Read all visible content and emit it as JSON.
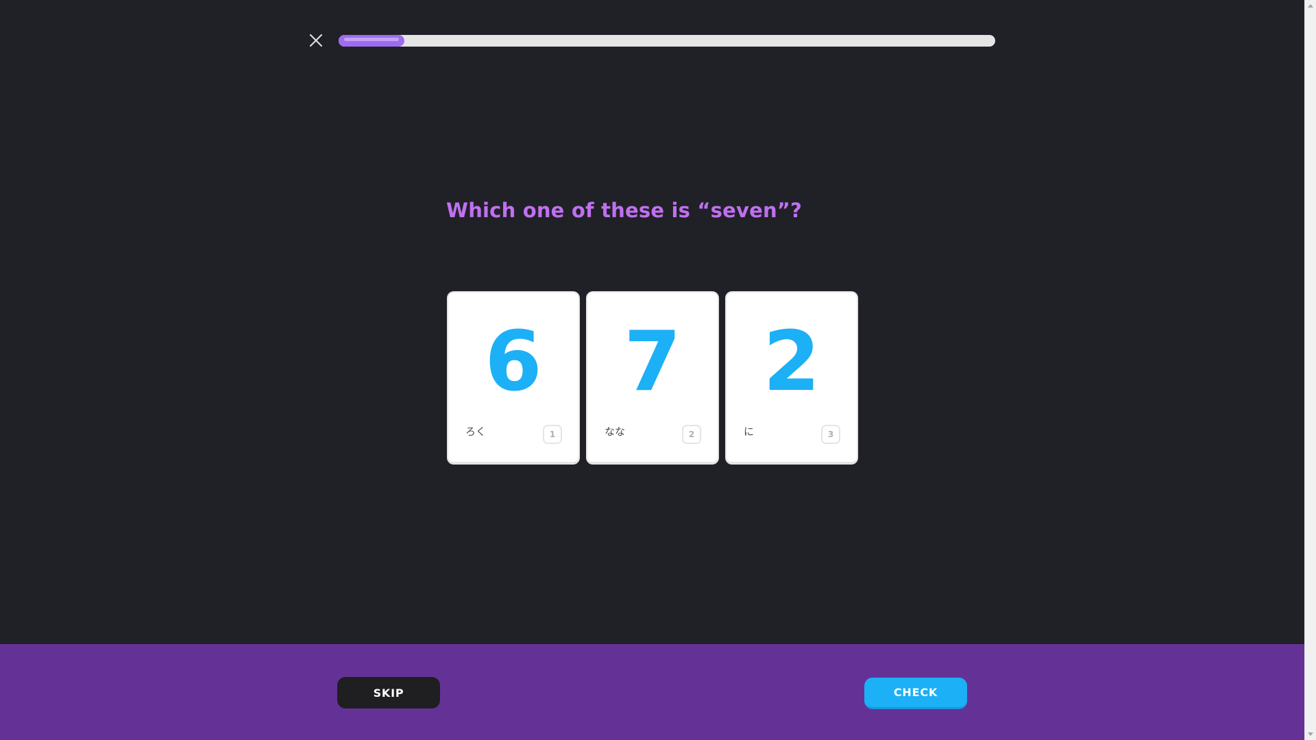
{
  "header": {
    "progress_fraction": 0.1
  },
  "question": {
    "text": "Which one of these is “seven”?"
  },
  "choices": [
    {
      "numeral": "6",
      "label": "ろく",
      "key": "1"
    },
    {
      "numeral": "7",
      "label": "なな",
      "key": "2"
    },
    {
      "numeral": "2",
      "label": "に",
      "key": "3"
    }
  ],
  "footer": {
    "skip_label": "SKIP",
    "check_label": "CHECK"
  },
  "colors": {
    "background": "#202126",
    "accent_purple": "#c070f0",
    "progress_fill": "#9f6bf0",
    "numeral_blue": "#1cb0f6",
    "footer_bg": "#643296"
  },
  "icons": {
    "close": "close-icon"
  }
}
